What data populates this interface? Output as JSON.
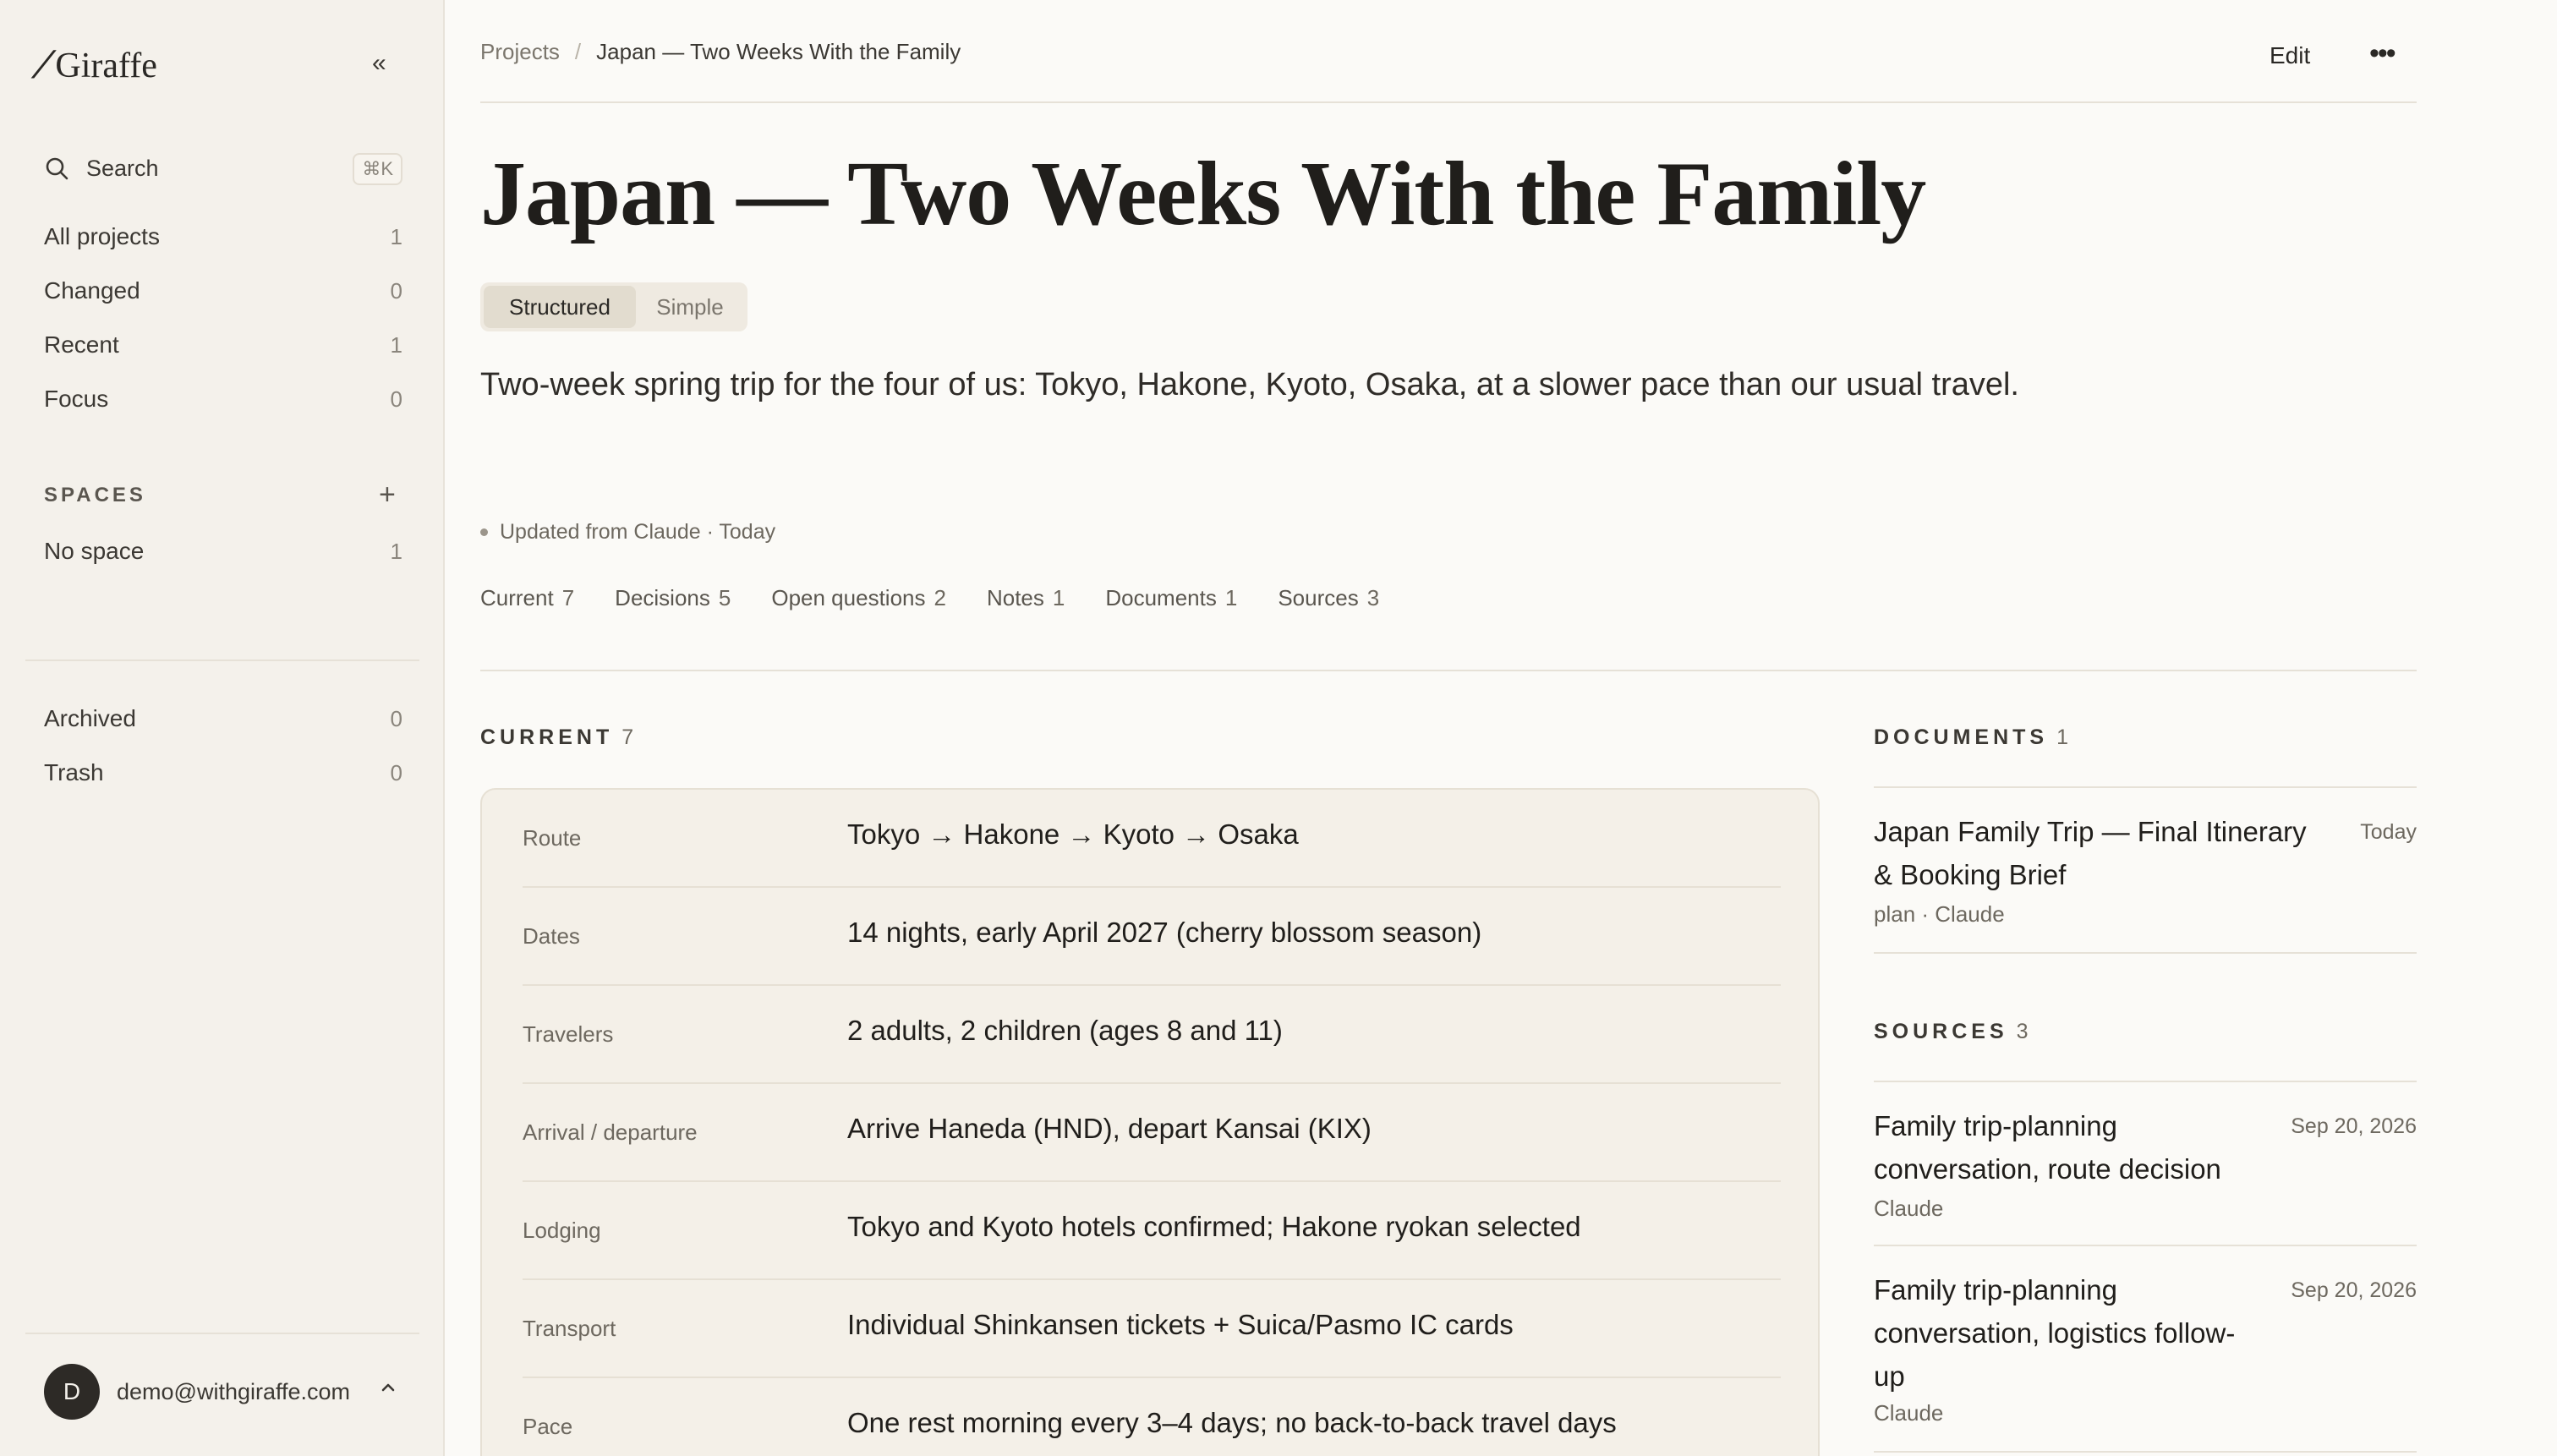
{
  "sidebar": {
    "brand_mark": "⁄",
    "brand_name": "Giraffe",
    "collapse_icon": "«",
    "search_label": "Search",
    "search_shortcut": "⌘K",
    "nav": [
      {
        "label": "All projects",
        "count": "1"
      },
      {
        "label": "Changed",
        "count": "0"
      },
      {
        "label": "Recent",
        "count": "1"
      },
      {
        "label": "Focus",
        "count": "0"
      }
    ],
    "spaces_label": "SPACES",
    "spaces": [
      {
        "label": "No space",
        "count": "1"
      }
    ],
    "bottom_nav": [
      {
        "label": "Archived",
        "count": "0"
      },
      {
        "label": "Trash",
        "count": "0"
      }
    ],
    "account": {
      "initial": "D",
      "email": "demo@withgiraffe.com"
    }
  },
  "header": {
    "breadcrumb_root": "Projects",
    "breadcrumb_sep": "/",
    "breadcrumb_current": "Japan — Two Weeks With the Family",
    "edit_label": "Edit",
    "more_label": "•••"
  },
  "project": {
    "title": "Japan — Two Weeks With the Family",
    "view_modes": [
      "Structured",
      "Simple"
    ],
    "summary": "Two-week spring trip for the four of us: Tokyo, Hakone, Kyoto, Osaka, at a slower pace than our usual travel.",
    "updated": "Updated from Claude · Today",
    "tabs": [
      {
        "label": "Current",
        "count": "7"
      },
      {
        "label": "Decisions",
        "count": "5"
      },
      {
        "label": "Open questions",
        "count": "2"
      },
      {
        "label": "Notes",
        "count": "1"
      },
      {
        "label": "Documents",
        "count": "1"
      },
      {
        "label": "Sources",
        "count": "3"
      }
    ]
  },
  "current": {
    "heading": "CURRENT",
    "count": "7",
    "rows": [
      {
        "label": "Route",
        "value": "Tokyo → Hakone → Kyoto → Osaka"
      },
      {
        "label": "Dates",
        "value": "14 nights, early April 2027 (cherry blossom season)"
      },
      {
        "label": "Travelers",
        "value": "2 adults, 2 children (ages 8 and 11)"
      },
      {
        "label": "Arrival / departure",
        "value": "Arrive Haneda (HND), depart Kansai (KIX)"
      },
      {
        "label": "Lodging",
        "value": "Tokyo and Kyoto hotels confirmed; Hakone ryokan selected"
      },
      {
        "label": "Transport",
        "value": "Individual Shinkansen tickets + Suica/Pasmo IC cards"
      },
      {
        "label": "Pace",
        "value": "One rest morning every 3–4 days; no back-to-back travel days"
      }
    ]
  },
  "documents": {
    "heading": "DOCUMENTS",
    "count": "1",
    "items": [
      {
        "title": "Japan Family Trip — Final Itinerary & Booking Brief",
        "date": "Today",
        "meta": "plan · Claude"
      }
    ]
  },
  "sources": {
    "heading": "SOURCES",
    "count": "3",
    "items": [
      {
        "title": "Family trip-planning conversation, route decision",
        "date": "Sep 20, 2026",
        "meta": "Claude"
      },
      {
        "title": "Family trip-planning conversation, logistics follow-up",
        "date": "Sep 20, 2026",
        "meta": "Claude"
      }
    ]
  }
}
